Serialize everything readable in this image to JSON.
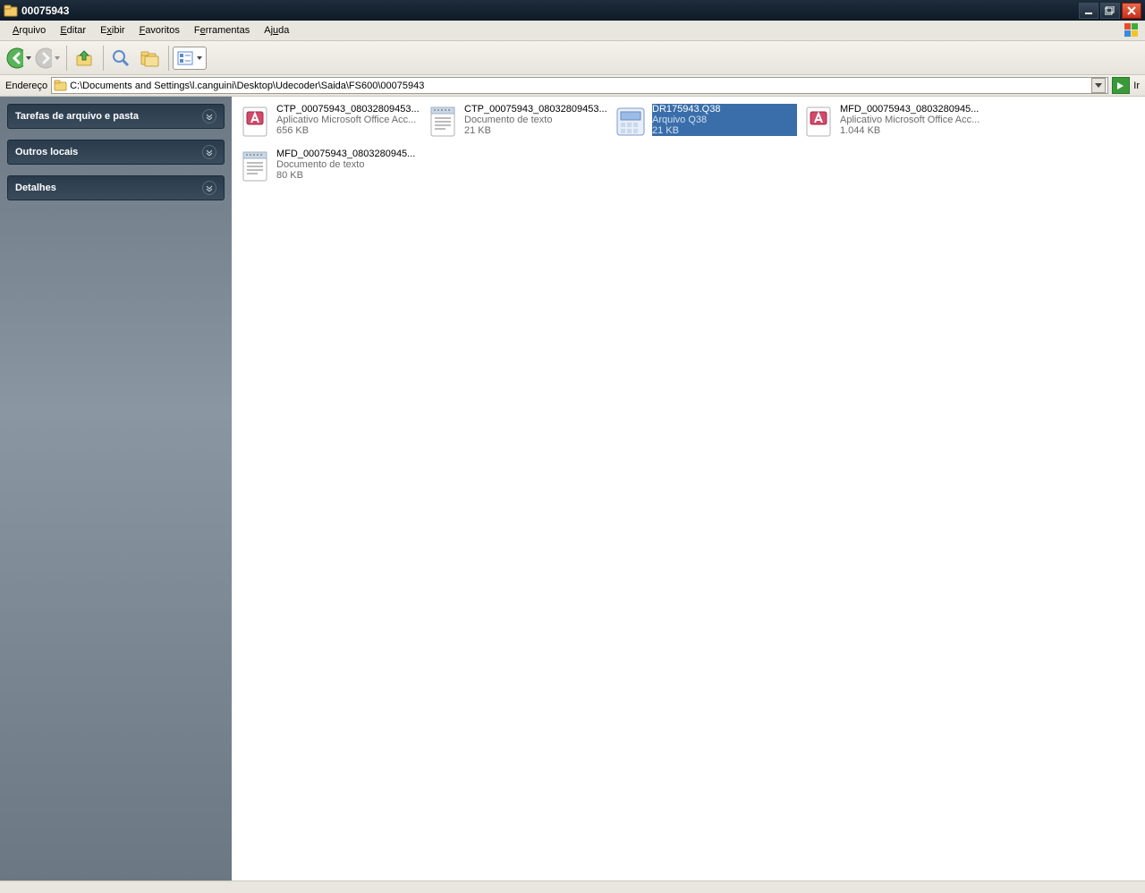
{
  "title": "00075943",
  "menu": {
    "arquivo": "Arquivo",
    "editar": "Editar",
    "exibir": "Exibir",
    "favoritos": "Favoritos",
    "ferramentas": "Ferramentas",
    "ajuda": "Ajuda"
  },
  "address": {
    "label": "Endereço",
    "path": "C:\\Documents and Settings\\l.canguini\\Desktop\\Udecoder\\Saida\\FS600\\00075943",
    "go": "Ir"
  },
  "sidebar": {
    "tasks": "Tarefas de arquivo e pasta",
    "other": "Outros locais",
    "details": "Detalhes"
  },
  "files": [
    {
      "name": "CTP_00075943_08032809453...",
      "type": "Aplicativo Microsoft Office Acc...",
      "size": "656 KB",
      "icon": "access",
      "selected": false
    },
    {
      "name": "CTP_00075943_08032809453...",
      "type": "Documento de texto",
      "size": "21 KB",
      "icon": "text",
      "selected": false
    },
    {
      "name": "DR175943.Q38",
      "type": "Arquivo Q38",
      "size": "21 KB",
      "icon": "generic",
      "selected": true
    },
    {
      "name": "MFD_00075943_0803280945...",
      "type": "Aplicativo Microsoft Office Acc...",
      "size": "1.044 KB",
      "icon": "access",
      "selected": false
    },
    {
      "name": "MFD_00075943_0803280945...",
      "type": "Documento de texto",
      "size": "80 KB",
      "icon": "text",
      "selected": false
    }
  ]
}
